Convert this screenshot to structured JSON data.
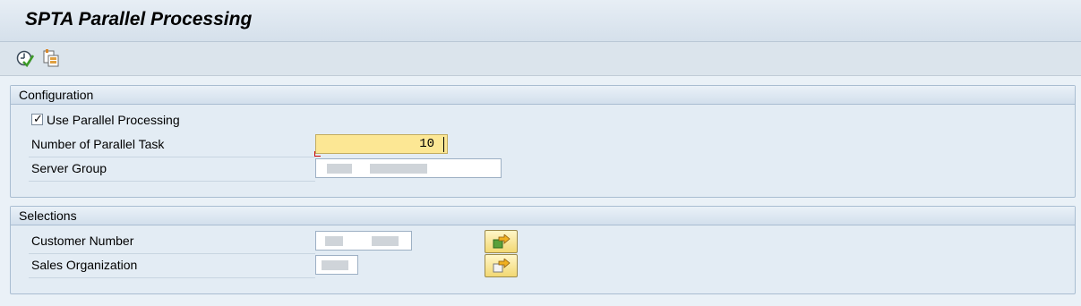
{
  "title": "SPTA Parallel Processing",
  "toolbar": {
    "execute_icon": "execute-clock-check-icon",
    "variant_icon": "get-variant-icon"
  },
  "configuration": {
    "heading": "Configuration",
    "use_parallel_label": "Use Parallel Processing",
    "use_parallel_checked": true,
    "check_glyph": "✓",
    "parallel_task_label": "Number of Parallel Task",
    "parallel_task_value": "10",
    "server_group_label": "Server Group",
    "server_group_value": ""
  },
  "selections": {
    "heading": "Selections",
    "customer_label": "Customer Number",
    "customer_value": "",
    "sales_org_label": "Sales Organization",
    "sales_org_value": "",
    "multiple_selection_icon": "multiple-selection-arrow-icon"
  },
  "colors": {
    "active_field": "#fce794",
    "group_border": "#a9bdd1",
    "background": "#eaf1f7"
  }
}
